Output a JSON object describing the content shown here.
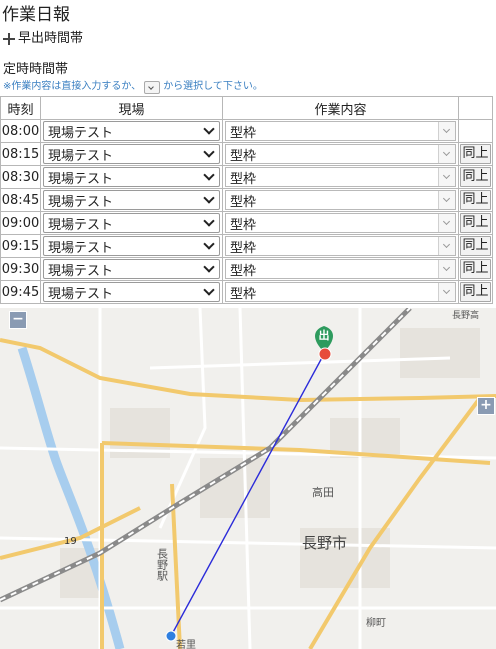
{
  "page": {
    "title": "作業日報"
  },
  "early": {
    "label": "早出時間帯"
  },
  "regular": {
    "title": "定時時間帯",
    "hint_before": "※作業内容は直接入力するか、",
    "hint_after": "から選択して下さい。"
  },
  "table": {
    "headers": {
      "time": "時刻",
      "site": "現場",
      "work": "作業内容"
    },
    "rows": [
      {
        "time": "08:00",
        "site": "現場テスト",
        "work": "型枠",
        "same": ""
      },
      {
        "time": "08:15",
        "site": "現場テスト",
        "work": "型枠",
        "same": "同上"
      },
      {
        "time": "08:30",
        "site": "現場テスト",
        "work": "型枠",
        "same": "同上"
      },
      {
        "time": "08:45",
        "site": "現場テスト",
        "work": "型枠",
        "same": "同上"
      },
      {
        "time": "09:00",
        "site": "現場テスト",
        "work": "型枠",
        "same": "同上"
      },
      {
        "time": "09:15",
        "site": "現場テスト",
        "work": "型枠",
        "same": "同上"
      },
      {
        "time": "09:30",
        "site": "現場テスト",
        "work": "型枠",
        "same": "同上"
      },
      {
        "time": "09:45",
        "site": "現場テスト",
        "work": "型枠",
        "same": "同上"
      }
    ]
  },
  "map": {
    "zoom_out": "−",
    "zoom_in": "+",
    "start_marker_label": "出",
    "labels": {
      "takada": "高田",
      "nagano_city": "長野市",
      "nagano_station": "長野駅",
      "route": "19",
      "wakasato": "若里",
      "yagyo": "柳町",
      "top_right": "長野高"
    }
  },
  "colors": {
    "hint": "#3a7fc1",
    "route_line": "#2b2bd9",
    "marker_green": "#2e9b5e",
    "marker_red": "#e74c3c",
    "marker_blue": "#2f7fe0",
    "major_road": "#f2c96d",
    "railway": "#8a8a8a",
    "river": "#a7cdee"
  }
}
